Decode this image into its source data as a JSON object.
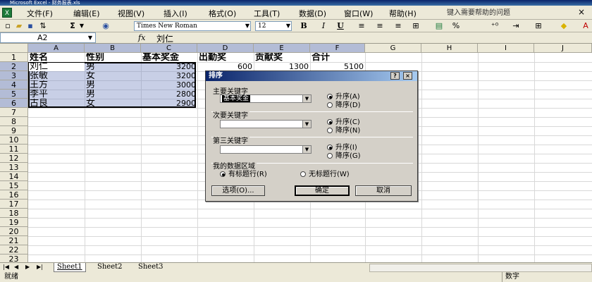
{
  "window": {
    "title": "Microsoft Excel - 财务报表.xls"
  },
  "menu": {
    "items": [
      "文件(F)",
      "编辑(E)",
      "视图(V)",
      "插入(I)",
      "格式(O)",
      "工具(T)",
      "数据(D)",
      "窗口(W)",
      "帮助(H)"
    ],
    "help_placeholder": "键入需要帮助的问题",
    "window_close": "×"
  },
  "toolbar": {
    "font_name": "Times New Roman",
    "font_size": "12",
    "bold": "B",
    "italic": "I",
    "underline": "U",
    "percent": "%",
    "sum": "Σ",
    "fx": "fx"
  },
  "formula_bar": {
    "name_box": "A2",
    "fx_label": "fx",
    "formula": "刘仁"
  },
  "sheet": {
    "columns": [
      "A",
      "B",
      "C",
      "D",
      "E",
      "F",
      "G",
      "H",
      "I",
      "J"
    ],
    "rows": [
      "1",
      "2",
      "3",
      "4",
      "5",
      "6",
      "7",
      "8",
      "9",
      "10",
      "11",
      "12",
      "13",
      "14",
      "15",
      "16",
      "17",
      "18",
      "19",
      "20",
      "21",
      "22",
      "23"
    ],
    "header_row": [
      "姓名",
      "性别",
      "基本奖金",
      "出勤奖",
      "贡献奖",
      "合计"
    ],
    "data_rows": [
      {
        "name": "刘仁",
        "gender": "男",
        "bonus": "3200",
        "attendance": "600",
        "contribution": "1300",
        "total": "5100"
      },
      {
        "name": "张敏",
        "gender": "女",
        "bonus": "3200",
        "attendance": "",
        "contribution": "",
        "total": ""
      },
      {
        "name": "王方",
        "gender": "男",
        "bonus": "3000",
        "attendance": "",
        "contribution": "",
        "total": ""
      },
      {
        "name": "李平",
        "gender": "男",
        "bonus": "2800",
        "attendance": "",
        "contribution": "",
        "total": ""
      },
      {
        "name": "古良",
        "gender": "女",
        "bonus": "2900",
        "attendance": "",
        "contribution": "",
        "total": ""
      }
    ]
  },
  "sheet_tabs": [
    "Sheet1",
    "Sheet2",
    "Sheet3"
  ],
  "status": {
    "left": "就绪",
    "right": "数字"
  },
  "sort_dialog": {
    "title": "排序",
    "help": "?",
    "close": "×",
    "primary_label": "主要关键字",
    "primary_value": "基本奖金",
    "secondary_label": "次要关键字",
    "secondary_value": "",
    "tertiary_label": "第三关键字",
    "tertiary_value": "",
    "ascending_a": "升序(A)",
    "descending_d": "降序(D)",
    "ascending_c": "升序(C)",
    "descending_n": "降序(N)",
    "ascending_i": "升序(I)",
    "descending_g": "降序(G)",
    "data_range_label": "我的数据区域",
    "has_header": "有标题行(R)",
    "no_header": "无标题行(W)",
    "options_button": "选项(O)...",
    "ok_button": "确定",
    "cancel_button": "取消"
  }
}
